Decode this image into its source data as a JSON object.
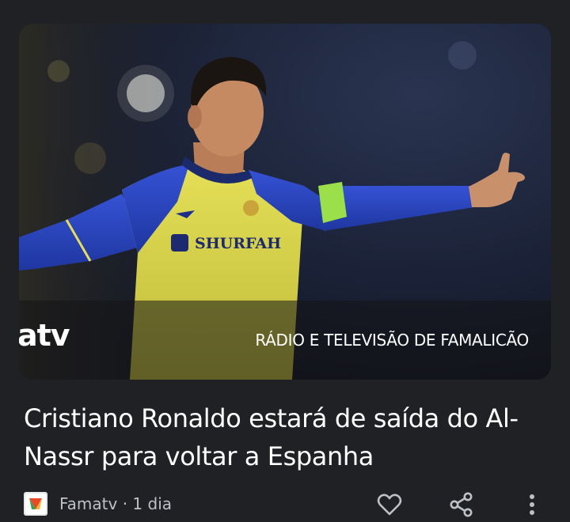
{
  "article": {
    "image_caption_logo": "atv",
    "image_caption_text": "RÁDIO E TELEVISÃO DE FAMALICÃO",
    "jersey_sponsor": "SHURFAH",
    "headline": "Cristiano Ronaldo estará de saída do Al-Nassr para voltar a Espanha",
    "source": "Famatv",
    "separator": " · ",
    "age": "1 dia"
  },
  "icons": {
    "source": "famatv-logo-icon",
    "like": "heart-icon",
    "share": "share-icon",
    "more": "more-vertical-icon"
  },
  "colors": {
    "background": "#202124",
    "headline": "#ffffff",
    "meta": "#bdc1c6",
    "jersey_yellow": "#d8d44a",
    "jersey_blue": "#2846b8"
  }
}
